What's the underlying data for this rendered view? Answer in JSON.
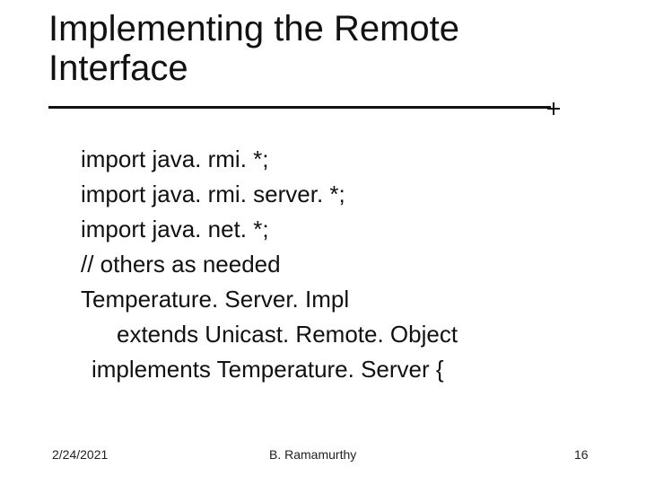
{
  "title": "Implementing the Remote Interface",
  "body": {
    "l1": "import java. rmi. *;",
    "l2": "import java. rmi. server. *;",
    "l3": "import java. net. *;",
    "l4": "// others as needed",
    "l5": "Temperature. Server. Impl",
    "l6": "extends Unicast. Remote. Object",
    "l7": "implements Temperature. Server {"
  },
  "footer": {
    "date": "2/24/2021",
    "author": "B. Ramamurthy",
    "page": "16"
  }
}
